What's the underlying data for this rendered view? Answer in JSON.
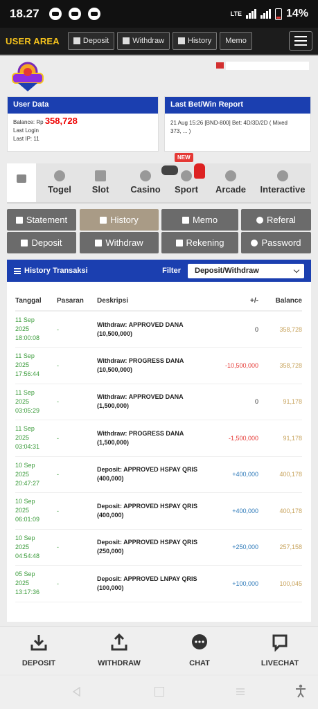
{
  "status": {
    "time": "18.27",
    "network": "LTE",
    "battery": "14%"
  },
  "nav": {
    "user_area": "USER AREA",
    "deposit": "Deposit",
    "withdraw": "Withdraw",
    "history": "History",
    "memo": "Memo"
  },
  "user_data": {
    "title": "User Data",
    "balance_label": "Balance: Rp",
    "balance_value": "358,728",
    "last_login_label": "Last Login",
    "last_ip_label": "Last IP: 11"
  },
  "last_report": {
    "title": "Last Bet/Win Report",
    "line1": "21 Aug 15:26 [BND-800] Bet: 4D/3D/2D ( Mixed",
    "line2": "373, ... )"
  },
  "categories": {
    "togel": "Togel",
    "slot": "Slot",
    "casino": "Casino",
    "sport": "Sport",
    "arcade": "Arcade",
    "interactive": "Interactive",
    "new_badge": "NEW"
  },
  "sub_menu": {
    "statement": "Statement",
    "history": "History",
    "memo": "Memo",
    "referal": "Referal",
    "deposit": "Deposit",
    "withdraw": "Withdraw",
    "rekening": "Rekening",
    "password": "Password"
  },
  "history": {
    "title": "History Transaksi",
    "filter_label": "Filter",
    "filter_value": "Deposit/Withdraw",
    "columns": [
      "Tanggal",
      "Pasaran",
      "Deskripsi",
      "+/-",
      "Balance"
    ],
    "rows": [
      {
        "d1": "11 Sep",
        "d2": "2025",
        "d3": "18:00:08",
        "pasaran": "-",
        "desc1": "Withdraw: APPROVED DANA",
        "desc2": "(10,500,000)",
        "amount": "0",
        "balance": "358,728"
      },
      {
        "d1": "11 Sep",
        "d2": "2025",
        "d3": "17:56:44",
        "pasaran": "-",
        "desc1": "Withdraw: PROGRESS DANA",
        "desc2": "(10,500,000)",
        "amount": "-10,500,000",
        "balance": "358,728"
      },
      {
        "d1": "11 Sep",
        "d2": "2025",
        "d3": "03:05:29",
        "pasaran": "-",
        "desc1": "Withdraw: APPROVED DANA",
        "desc2": "(1,500,000)",
        "amount": "0",
        "balance": "91,178"
      },
      {
        "d1": "11 Sep",
        "d2": "2025",
        "d3": "03:04:31",
        "pasaran": "-",
        "desc1": "Withdraw: PROGRESS DANA",
        "desc2": "(1,500,000)",
        "amount": "-1,500,000",
        "balance": "91,178"
      },
      {
        "d1": "10 Sep",
        "d2": "2025",
        "d3": "20:47:27",
        "pasaran": "-",
        "desc1": "Deposit: APPROVED HSPAY QRIS",
        "desc2": "(400,000)",
        "amount": "+400,000",
        "balance": "400,178"
      },
      {
        "d1": "10 Sep",
        "d2": "2025",
        "d3": "06:01:09",
        "pasaran": "-",
        "desc1": "Deposit: APPROVED HSPAY QRIS",
        "desc2": "(400,000)",
        "amount": "+400,000",
        "balance": "400,178"
      },
      {
        "d1": "10 Sep",
        "d2": "2025",
        "d3": "04:54:48",
        "pasaran": "-",
        "desc1": "Deposit: APPROVED HSPAY QRIS",
        "desc2": "(250,000)",
        "amount": "+250,000",
        "balance": "257,158"
      },
      {
        "d1": "05 Sep",
        "d2": "2025",
        "d3": "13:17:36",
        "pasaran": "-",
        "desc1": "Deposit: APPROVED LNPAY QRIS",
        "desc2": "(100,000)",
        "amount": "+100,000",
        "balance": "100,045"
      }
    ]
  },
  "bottom_nav": {
    "deposit": "DEPOSIT",
    "withdraw": "WITHDRAW",
    "chat": "CHAT",
    "livechat": "LIVECHAT"
  },
  "colors": {
    "brand_blue": "#1b3fb0",
    "accent_yellow": "#f6c31c",
    "negative": "#e53935",
    "positive": "#2b78b8",
    "balance_gold": "#c7a25a",
    "date_green": "#3a9b3a"
  }
}
